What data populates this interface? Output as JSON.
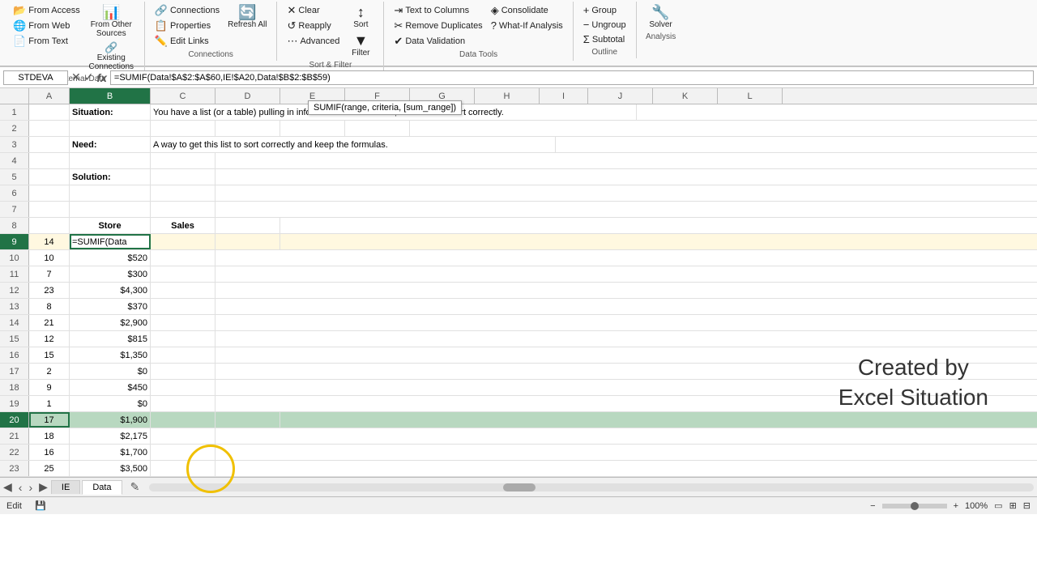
{
  "ribbon": {
    "groups": [
      {
        "label": "Get External Data",
        "buttons": [
          {
            "id": "from-access",
            "icon": "📂",
            "label": "From Access"
          },
          {
            "id": "from-web",
            "icon": "🌐",
            "label": "From Web"
          },
          {
            "id": "from-text",
            "icon": "📄",
            "label": "From Text"
          },
          {
            "id": "from-other",
            "icon": "📊",
            "label": "From Other Sources"
          },
          {
            "id": "existing-conn",
            "icon": "🔗",
            "label": "Existing Connections"
          }
        ]
      },
      {
        "label": "Connections",
        "buttons": [
          {
            "id": "connections",
            "icon": "🔗",
            "label": "Connections"
          },
          {
            "id": "properties",
            "icon": "📋",
            "label": "Properties"
          },
          {
            "id": "edit-links",
            "icon": "✏️",
            "label": "Edit Links"
          },
          {
            "id": "refresh-all",
            "icon": "🔄",
            "label": "Refresh All"
          }
        ]
      },
      {
        "label": "Sort & Filter",
        "buttons": [
          {
            "id": "sort",
            "icon": "↕",
            "label": "Sort"
          },
          {
            "id": "filter",
            "icon": "▼",
            "label": "Filter"
          },
          {
            "id": "clear",
            "icon": "✕",
            "label": "Clear"
          },
          {
            "id": "reapply",
            "icon": "↺",
            "label": "Reapply"
          },
          {
            "id": "advanced",
            "icon": "⋯",
            "label": "Advanced"
          }
        ]
      },
      {
        "label": "Data Tools",
        "buttons": [
          {
            "id": "text-to-col",
            "icon": "⇥",
            "label": "Text to Columns"
          },
          {
            "id": "remove-dup",
            "icon": "✂",
            "label": "Remove Duplicates"
          },
          {
            "id": "data-val",
            "icon": "✔",
            "label": "Data Validation"
          },
          {
            "id": "consolidate",
            "icon": "◈",
            "label": "Consolidate"
          },
          {
            "id": "whatif",
            "icon": "?",
            "label": "What-If Analysis"
          }
        ]
      },
      {
        "label": "Outline",
        "buttons": [
          {
            "id": "group",
            "icon": "+",
            "label": "Group"
          },
          {
            "id": "ungroup",
            "icon": "−",
            "label": "Ungroup"
          },
          {
            "id": "subtotal",
            "icon": "Σ",
            "label": "Subtotal"
          }
        ]
      },
      {
        "label": "Analysis",
        "buttons": [
          {
            "id": "solver",
            "icon": "🔧",
            "label": "Solver"
          }
        ]
      }
    ]
  },
  "formula_bar": {
    "name_box": "STDEVA",
    "cancel_icon": "✕",
    "confirm_icon": "✓",
    "formula_icon": "fx",
    "formula": "=SUMIF(Data!$A$2:$A$60,IE!$A20,Data!$B$2:$B$59)",
    "tooltip": "SUMIF(range, criteria, [sum_range])"
  },
  "columns": [
    {
      "id": "A",
      "label": "A",
      "width": 50
    },
    {
      "id": "B",
      "label": "B",
      "width": 100
    },
    {
      "id": "C",
      "label": "C",
      "width": 80
    },
    {
      "id": "D",
      "label": "D",
      "width": 80
    },
    {
      "id": "E",
      "label": "E",
      "width": 80
    },
    {
      "id": "F",
      "label": "F",
      "width": 80
    },
    {
      "id": "G",
      "label": "G",
      "width": 80
    },
    {
      "id": "H",
      "label": "H",
      "width": 80
    },
    {
      "id": "I",
      "label": "I",
      "width": 60
    },
    {
      "id": "J",
      "label": "J",
      "width": 80
    },
    {
      "id": "K",
      "label": "K",
      "width": 80
    },
    {
      "id": "L",
      "label": "L",
      "width": 80
    }
  ],
  "rows": [
    {
      "num": 1,
      "cells": [
        {
          "col": "A",
          "val": "",
          "bold": false
        },
        {
          "col": "B",
          "val": "Situation:",
          "bold": true,
          "span": true
        },
        {
          "col": "C",
          "val": "You have a list (or a table) pulling in info with a SumIf formula, but it will not sort correctly.",
          "span_text": true
        }
      ]
    },
    {
      "num": 2,
      "cells": []
    },
    {
      "num": 3,
      "cells": [
        {
          "col": "A",
          "val": ""
        },
        {
          "col": "B",
          "val": "Need:",
          "bold": true
        },
        {
          "col": "C",
          "val": "A way to get this list to sort correctly and keep the formulas.",
          "span_text": true
        }
      ]
    },
    {
      "num": 4,
      "cells": []
    },
    {
      "num": 5,
      "cells": [
        {
          "col": "A",
          "val": ""
        },
        {
          "col": "B",
          "val": "Solution:",
          "bold": true
        }
      ]
    },
    {
      "num": 6,
      "cells": []
    },
    {
      "num": 7,
      "cells": []
    },
    {
      "num": 8,
      "cells": [
        {
          "col": "A",
          "val": "",
          "align": "center"
        },
        {
          "col": "B",
          "val": "Store",
          "bold": true,
          "align": "center"
        },
        {
          "col": "C",
          "val": "Sales",
          "bold": true,
          "align": "center"
        }
      ]
    },
    {
      "num": 9,
      "cells": [
        {
          "col": "A",
          "val": "14",
          "align": "center"
        },
        {
          "col": "B",
          "val": "=SUMIF(Data",
          "align": "left",
          "active": true
        },
        {
          "col": "C",
          "val": ""
        }
      ]
    },
    {
      "num": 10,
      "cells": [
        {
          "col": "A",
          "val": "10",
          "align": "center"
        },
        {
          "col": "B",
          "val": "$520",
          "align": "right"
        },
        {
          "col": "C",
          "val": ""
        }
      ]
    },
    {
      "num": 11,
      "cells": [
        {
          "col": "A",
          "val": "7",
          "align": "center"
        },
        {
          "col": "B",
          "val": "$300",
          "align": "right"
        }
      ]
    },
    {
      "num": 12,
      "cells": [
        {
          "col": "A",
          "val": "23",
          "align": "center"
        },
        {
          "col": "B",
          "val": "$4,300",
          "align": "right"
        }
      ]
    },
    {
      "num": 13,
      "cells": [
        {
          "col": "A",
          "val": "8",
          "align": "center"
        },
        {
          "col": "B",
          "val": "$370",
          "align": "right"
        }
      ]
    },
    {
      "num": 14,
      "cells": [
        {
          "col": "A",
          "val": "21",
          "align": "center"
        },
        {
          "col": "B",
          "val": "$2,900",
          "align": "right"
        }
      ]
    },
    {
      "num": 15,
      "cells": [
        {
          "col": "A",
          "val": "12",
          "align": "center"
        },
        {
          "col": "B",
          "val": "$815",
          "align": "right"
        }
      ]
    },
    {
      "num": 16,
      "cells": [
        {
          "col": "A",
          "val": "15",
          "align": "center"
        },
        {
          "col": "B",
          "val": "$1,350",
          "align": "right"
        }
      ]
    },
    {
      "num": 17,
      "cells": [
        {
          "col": "A",
          "val": "2",
          "align": "center"
        },
        {
          "col": "B",
          "val": "$0",
          "align": "right"
        }
      ]
    },
    {
      "num": 18,
      "cells": [
        {
          "col": "A",
          "val": "9",
          "align": "center"
        },
        {
          "col": "B",
          "val": "$450",
          "align": "right"
        }
      ]
    },
    {
      "num": 19,
      "cells": [
        {
          "col": "A",
          "val": "1",
          "align": "center"
        },
        {
          "col": "B",
          "val": "$0",
          "align": "right"
        }
      ]
    },
    {
      "num": 20,
      "cells": [
        {
          "col": "A",
          "val": "17",
          "align": "center",
          "selected_row": true
        },
        {
          "col": "B",
          "val": "$1,900",
          "align": "right",
          "selected_row": true
        },
        {
          "col": "C",
          "val": "",
          "selected_row": true
        }
      ]
    },
    {
      "num": 21,
      "cells": [
        {
          "col": "A",
          "val": "18",
          "align": "center"
        },
        {
          "col": "B",
          "val": "$2,175",
          "align": "right"
        }
      ]
    },
    {
      "num": 22,
      "cells": [
        {
          "col": "A",
          "val": "16",
          "align": "center"
        },
        {
          "col": "B",
          "val": "$1,700",
          "align": "right"
        }
      ]
    },
    {
      "num": 23,
      "cells": [
        {
          "col": "A",
          "val": "25",
          "align": "center"
        },
        {
          "col": "B",
          "val": "$3,500",
          "align": "right"
        }
      ]
    }
  ],
  "watermark": {
    "line1": "Created by",
    "line2": "Excel Situation"
  },
  "sheet_tabs": [
    "IE",
    "Data"
  ],
  "active_tab": "IE",
  "status_bar": {
    "mode": "Edit",
    "icons": [
      "💾"
    ]
  }
}
